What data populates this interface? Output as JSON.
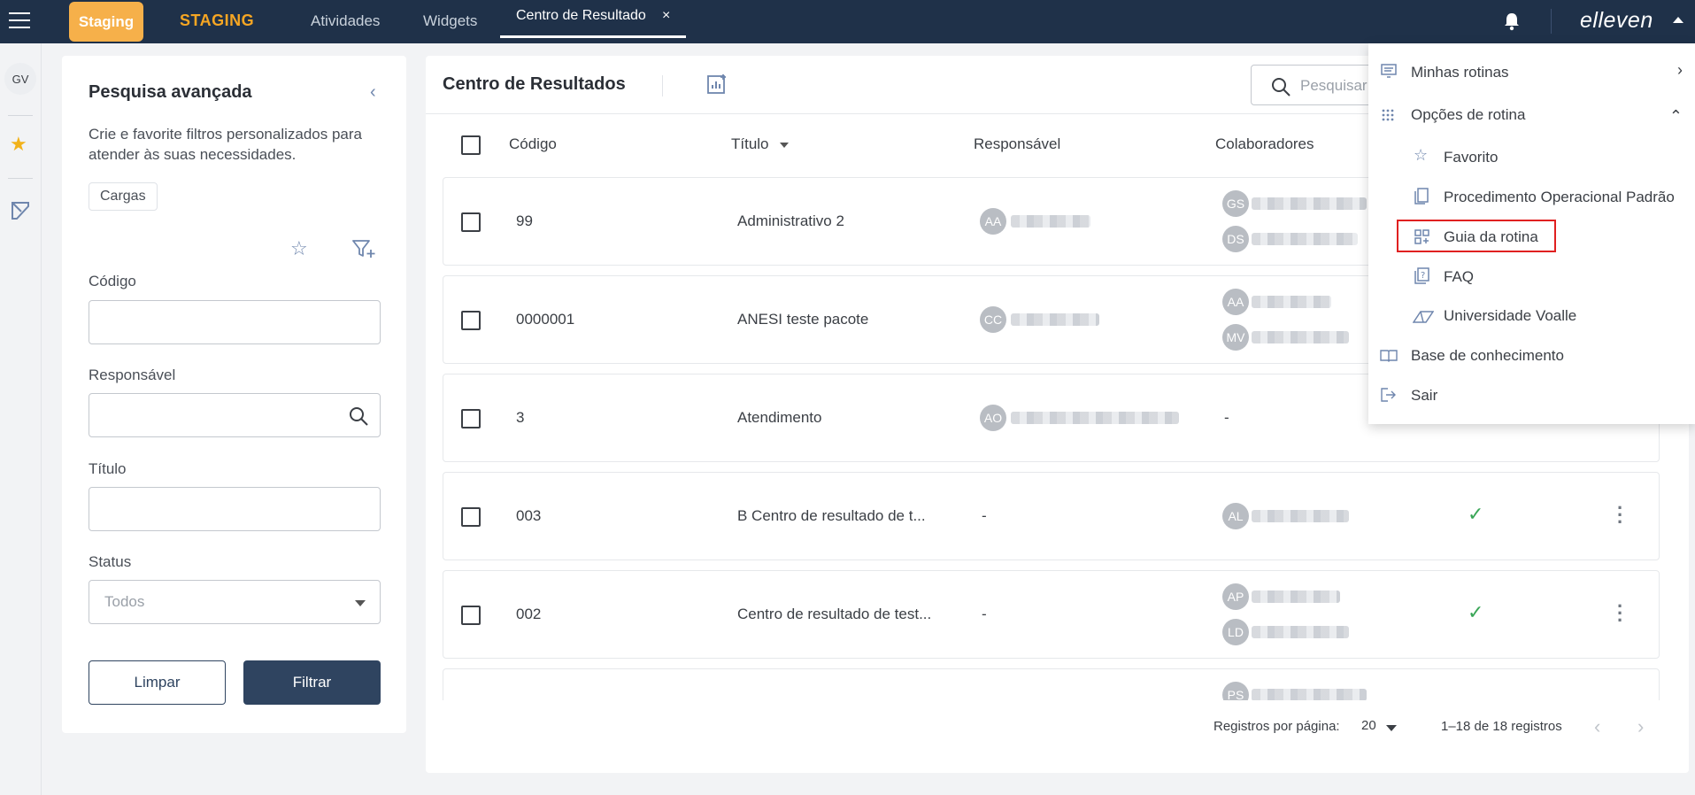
{
  "topbar": {
    "env_badge": "Staging",
    "env_logo": "STAGING",
    "tabs": [
      {
        "label": "Atividades"
      },
      {
        "label": "Widgets"
      },
      {
        "label": "Centro de Resultado"
      }
    ],
    "close_glyph": "×",
    "brand": "elleven"
  },
  "rail": {
    "avatar": "GV"
  },
  "filter": {
    "title": "Pesquisa avançada",
    "description": "Crie e favorite filtros personalizados para atender às suas necessidades.",
    "chip": "Cargas",
    "codigo_label": "Código",
    "responsavel_label": "Responsável",
    "titulo_label": "Título",
    "status_label": "Status",
    "status_placeholder": "Todos",
    "clear_label": "Limpar",
    "filter_label": "Filtrar"
  },
  "main": {
    "title": "Centro de Resultados",
    "search_placeholder": "Pesquisar",
    "columns": {
      "codigo": "Código",
      "titulo": "Título",
      "responsavel": "Responsável",
      "colaboradores": "Colaboradores"
    },
    "rows": [
      {
        "codigo": "99",
        "titulo": "Administrativo 2",
        "resp_initials": "AA",
        "collab": [
          "GS",
          "DS"
        ],
        "dash_resp": "",
        "dash_collab": "",
        "active": ""
      },
      {
        "codigo": "0000001",
        "titulo": "ANESI teste pacote",
        "resp_initials": "CC",
        "collab": [
          "AA",
          "MV"
        ],
        "dash_resp": "",
        "dash_collab": "",
        "active": ""
      },
      {
        "codigo": "3",
        "titulo": "Atendimento",
        "resp_initials": "AO",
        "collab": [],
        "dash_resp": "",
        "dash_collab": "-",
        "active": ""
      },
      {
        "codigo": "003",
        "titulo": "B Centro de resultado de t...",
        "resp_initials": "",
        "collab": [
          "AL"
        ],
        "dash_resp": "-",
        "dash_collab": "",
        "active": "✓"
      },
      {
        "codigo": "002",
        "titulo": "Centro de resultado de test...",
        "resp_initials": "",
        "collab": [
          "AP",
          "LD"
        ],
        "dash_resp": "-",
        "dash_collab": "",
        "active": "✓"
      },
      {
        "codigo": "",
        "titulo": "",
        "resp_initials": "",
        "collab": [
          "PS"
        ],
        "dash_resp": "",
        "dash_collab": "",
        "active": ""
      }
    ],
    "footer": {
      "per_page_label": "Registros por página:",
      "per_page_value": "20",
      "range": "1–18 de 18 registros",
      "prev": "‹",
      "next": "›"
    }
  },
  "menu": {
    "items": [
      {
        "label": "Minhas rotinas",
        "chevron": "›"
      },
      {
        "label": "Opções de rotina",
        "chevron": "⌃"
      },
      {
        "label": "Favorito"
      },
      {
        "label": "Procedimento Operacional Padrão"
      },
      {
        "label": "Guia da rotina"
      },
      {
        "label": "FAQ"
      },
      {
        "label": "Universidade Voalle"
      },
      {
        "label": "Base de conhecimento"
      },
      {
        "label": "Sair"
      }
    ]
  },
  "colors": {
    "topbar": "#1f3149",
    "accent": "#f6b04a",
    "primary_button": "#2f4460",
    "highlight": "#e02020",
    "check": "#3aa657"
  }
}
